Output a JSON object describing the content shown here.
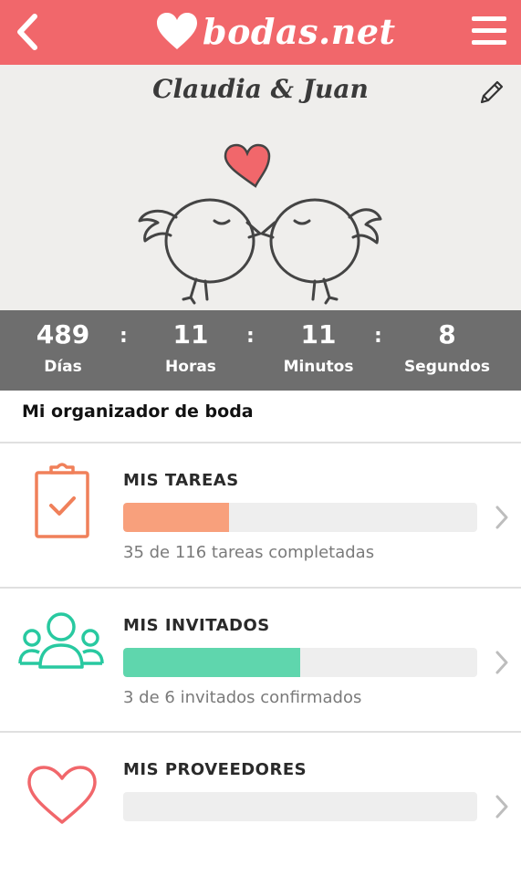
{
  "header": {
    "logo_text": "bodas.net",
    "back_icon": "chevron-left-icon",
    "menu_icon": "hamburger-menu-icon",
    "brand_color": "#f1676b"
  },
  "hero": {
    "couple_name": "Claudia & Juan",
    "edit_icon": "pencil-icon",
    "illustration": "love-birds-with-heart"
  },
  "countdown": {
    "days": "489",
    "days_label": "Días",
    "hours": "11",
    "hours_label": "Horas",
    "minutes": "11",
    "minutes_label": "Minutos",
    "seconds": "8",
    "seconds_label": "Segundos",
    "separator": ":"
  },
  "organizer": {
    "title": "Mi organizador de boda",
    "items": [
      {
        "title": "MIS TAREAS",
        "icon": "clipboard-check-icon",
        "progress": 0.3,
        "fill_color": "#f8a07c",
        "subtitle": "35 de 116 tareas completadas"
      },
      {
        "title": "MIS INVITADOS",
        "icon": "guests-group-icon",
        "progress": 0.5,
        "fill_color": "#5fd6ad",
        "subtitle": "3 de 6 invitados confirmados"
      },
      {
        "title": "MIS PROVEEDORES",
        "icon": "heart-outline-icon",
        "progress": 0,
        "fill_color": "#f1676b",
        "subtitle": ""
      }
    ]
  }
}
